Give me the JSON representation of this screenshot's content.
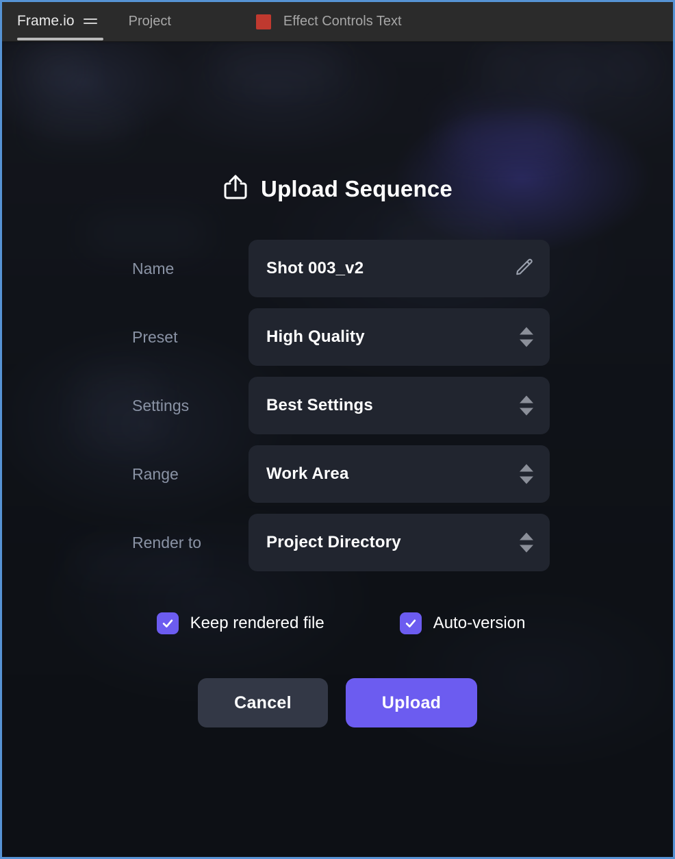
{
  "window": {
    "border_color": "#5693d4",
    "background_color": "#0f1218"
  },
  "topbar": {
    "brand": "Frame.io",
    "menu_icon": "hamburger-icon",
    "project_label": "Project",
    "document_chip_color": "#c0392f",
    "document_label": "Effect Controls Text"
  },
  "modal": {
    "icon": "upload-icon",
    "title": "Upload Sequence",
    "fields": [
      {
        "label": "Name",
        "value": "Shot 003_v2",
        "control": "text",
        "trailing_icon": "pencil-icon"
      },
      {
        "label": "Preset",
        "value": "High Quality",
        "control": "stepper",
        "trailing_icon": "stepper-arrows-icon"
      },
      {
        "label": "Settings",
        "value": "Best Settings",
        "control": "stepper",
        "trailing_icon": "stepper-arrows-icon"
      },
      {
        "label": "Range",
        "value": "Work Area",
        "control": "stepper",
        "trailing_icon": "stepper-arrows-icon"
      },
      {
        "label": "Render to",
        "value": "Project Directory",
        "control": "stepper",
        "trailing_icon": "stepper-arrows-icon"
      }
    ],
    "checkboxes": [
      {
        "label": "Keep rendered file",
        "checked": true
      },
      {
        "label": "Auto-version",
        "checked": true
      }
    ],
    "buttons": {
      "cancel": "Cancel",
      "upload": "Upload"
    },
    "accent_color": "#6c5cf0",
    "field_background": "#21252f",
    "cancel_background": "#333846"
  }
}
